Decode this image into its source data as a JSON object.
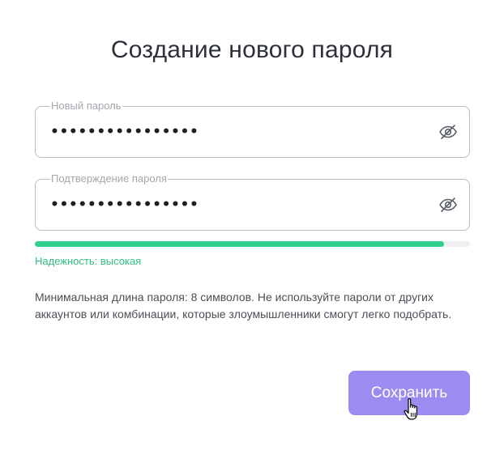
{
  "page": {
    "title": "Создание нового пароля"
  },
  "form": {
    "new_password": {
      "label": "Новый пароль",
      "value": "••••••••••••••••",
      "toggle_icon": "eye-off-icon"
    },
    "confirm_password": {
      "label": "Подтверждение пароля",
      "value": "••••••••••••••••",
      "toggle_icon": "eye-off-icon"
    },
    "strength": {
      "level": 0.94,
      "text": "Надежность: высокая",
      "color": "#31cf8d"
    },
    "hint": "Минимальная длина пароля: 8 символов. Не используйте пароли от других аккаунтов или комбинации, которые злоумышленники смогут легко подобрать."
  },
  "actions": {
    "save_label": "Сохранить",
    "save_color": "#9c8cf2"
  },
  "cursor": {
    "icon": "hand-pointer-icon"
  }
}
